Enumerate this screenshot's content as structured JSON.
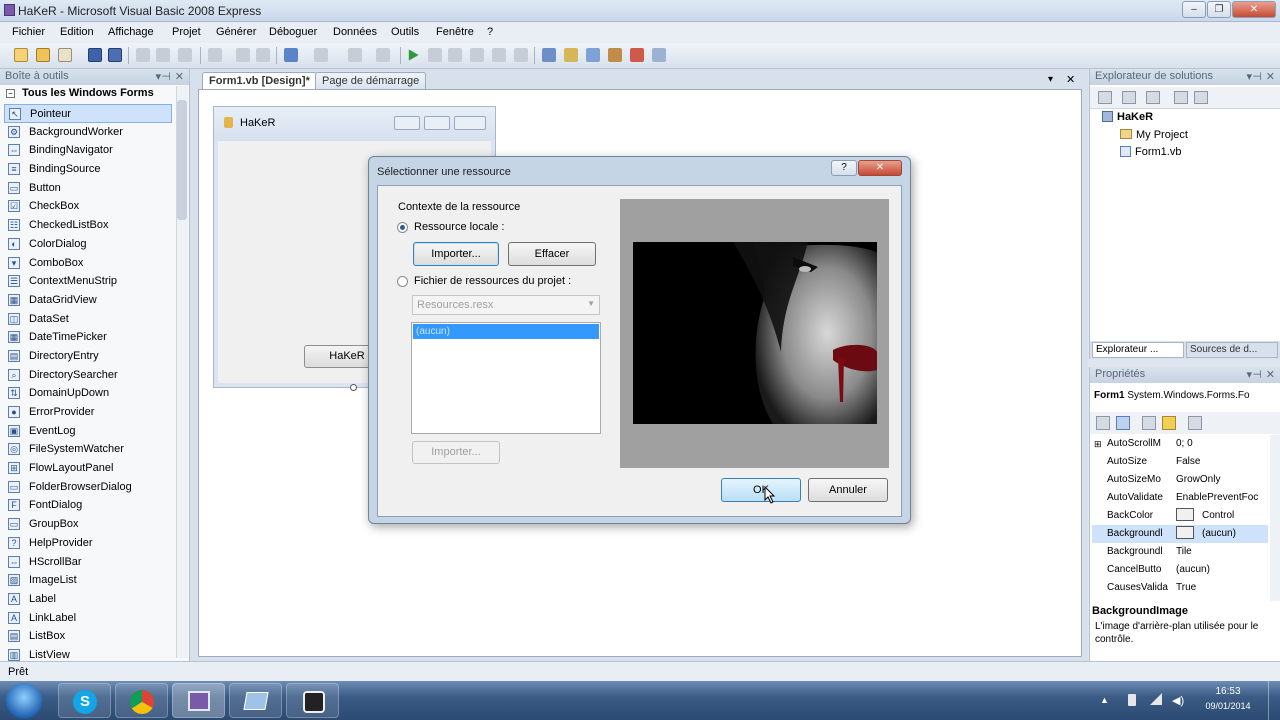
{
  "window": {
    "title": "HaKeR - Microsoft Visual Basic 2008 Express",
    "controls": [
      "–",
      "❐",
      "✕"
    ]
  },
  "menu": [
    "Fichier",
    "Edition",
    "Affichage",
    "Projet",
    "Générer",
    "Déboguer",
    "Données",
    "Outils",
    "Fenêtre",
    "?"
  ],
  "toolbox": {
    "title": "Boîte à outils",
    "group": "Tous les Windows Forms",
    "items": [
      "Pointeur",
      "BackgroundWorker",
      "BindingNavigator",
      "BindingSource",
      "Button",
      "CheckBox",
      "CheckedListBox",
      "ColorDialog",
      "ComboBox",
      "ContextMenuStrip",
      "DataGridView",
      "DataSet",
      "DateTimePicker",
      "DirectoryEntry",
      "DirectorySearcher",
      "DomainUpDown",
      "ErrorProvider",
      "EventLog",
      "FileSystemWatcher",
      "FlowLayoutPanel",
      "FolderBrowserDialog",
      "FontDialog",
      "GroupBox",
      "HelpProvider",
      "HScrollBar",
      "ImageList",
      "Label",
      "LinkLabel",
      "ListBox",
      "ListView"
    ]
  },
  "tabs": [
    "Form1.vb [Design]*",
    "Page de démarrage"
  ],
  "form": {
    "title": "HaKeR",
    "button": "HaKeR"
  },
  "dialog": {
    "title": "Sélectionner une ressource",
    "group_label": "Contexte de la ressource",
    "radio_local": "Ressource locale :",
    "import_btn": "Importer...",
    "clear_btn": "Effacer",
    "radio_project": "Fichier de ressources du projet :",
    "resx_select": "Resources.resx",
    "list_selected": "(aucun)",
    "import2_btn": "Importer...",
    "ok_btn": "OK",
    "cancel_btn": "Annuler"
  },
  "solution": {
    "title": "Explorateur de solutions",
    "project": "HaKeR",
    "children": [
      "My Project",
      "Form1.vb"
    ],
    "tabs": [
      "Explorateur ...",
      "Sources de d..."
    ]
  },
  "properties": {
    "title": "Propriétés",
    "object": "Form1",
    "object_type": "System.Windows.Forms.Fo",
    "rows": [
      {
        "name": "AutoScrollM",
        "value": "0; 0"
      },
      {
        "name": "AutoSize",
        "value": "False"
      },
      {
        "name": "AutoSizeMo",
        "value": "GrowOnly"
      },
      {
        "name": "AutoValidate",
        "value": "EnablePreventFoc"
      },
      {
        "name": "BackColor",
        "value": "Control"
      },
      {
        "name": "Backgroundl",
        "value": "(aucun)"
      },
      {
        "name": "Backgroundl",
        "value": "Tile"
      },
      {
        "name": "CancelButto",
        "value": "(aucun)"
      },
      {
        "name": "CausesValida",
        "value": "True"
      }
    ],
    "desc_title": "BackgroundImage",
    "desc_text": "L'image d'arrière-plan utilisée pour le contrôle."
  },
  "status": "Prêt",
  "clock": {
    "time": "16:53",
    "date": "09/01/2014"
  },
  "colors": {
    "accent": "#3399ff",
    "titlebar": "#c9d8ea",
    "taskbar": "#3b5c86"
  }
}
